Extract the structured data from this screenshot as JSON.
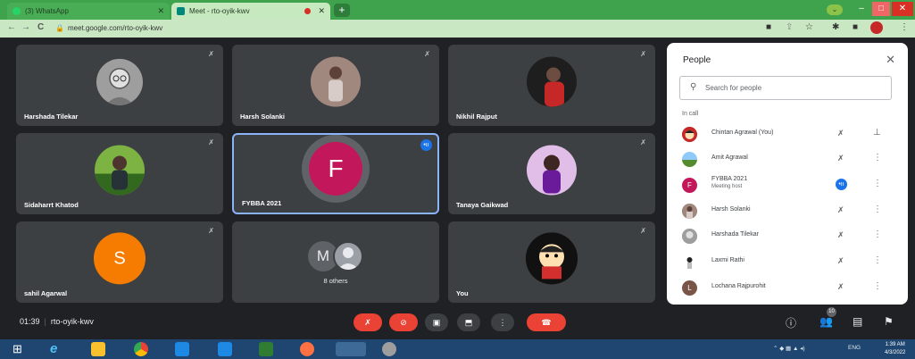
{
  "browser": {
    "tabs": [
      {
        "title": "(3) WhatsApp",
        "favicon_color": "#25d366"
      },
      {
        "title": "Meet - rto-oyik-kwv",
        "favicon_color": "#00897b"
      }
    ],
    "url": "meet.google.com/rto-oyik-kwv",
    "new_tab_label": "+",
    "nav_back": "←",
    "nav_forward": "→",
    "nav_reload": "C"
  },
  "meeting": {
    "time": "01:39",
    "code": "rto-oyik-kwv",
    "participant_count": "10"
  },
  "tiles": [
    {
      "name": "Harshada Tilekar"
    },
    {
      "name": "Harsh Solanki"
    },
    {
      "name": "Nikhil Rajput"
    },
    {
      "name": "Sidaharrt Khatod"
    },
    {
      "name": "FYBBA 2021",
      "initial": "F"
    },
    {
      "name": "Tanaya Gaikwad"
    },
    {
      "name": "sahil Agarwal",
      "initial": "S"
    },
    {
      "name": "8 others",
      "initial": "M"
    },
    {
      "name": "You"
    }
  ],
  "people_panel": {
    "title": "People",
    "close": "✕",
    "search_placeholder": "Search for people",
    "section": "In call",
    "people": [
      {
        "name": "Chintan Agrawal (You)"
      },
      {
        "name": "Amit Agrawal"
      },
      {
        "name": "FYBBA 2021",
        "sub": "Meeting host",
        "initial": "F"
      },
      {
        "name": "Harsh Solanki"
      },
      {
        "name": "Harshada Tilekar"
      },
      {
        "name": "Laxmi Rathi"
      },
      {
        "name": "Lochana Rajpurohit",
        "initial": "L"
      }
    ]
  },
  "taskbar": {
    "lang": "ENG",
    "time": "1:39 AM",
    "date": "4/3/2022"
  },
  "colors": {
    "meet_bg": "#202124",
    "tile_bg": "#3c4043",
    "red_control": "#ea4335",
    "accent_blue": "#1a73e8",
    "browser_green": "#3fa34d",
    "taskbar_blue": "#1e4670"
  }
}
